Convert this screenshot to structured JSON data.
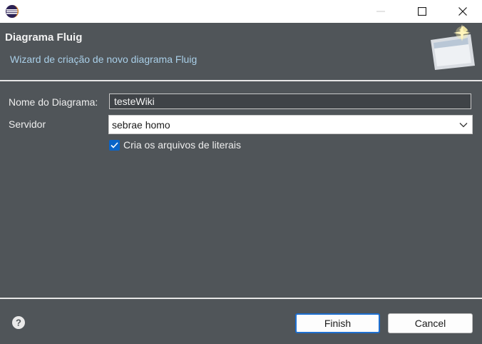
{
  "window": {
    "app_icon": "eclipse-icon",
    "controls": [
      "minimize-icon",
      "maximize-icon",
      "close-icon"
    ]
  },
  "header": {
    "title": "Diagrama Fluig",
    "description": "Wizard de criação de novo diagrama Fluig",
    "banner_icon": "new-wizard-banner-icon"
  },
  "form": {
    "name_label": "Nome do Diagrama:",
    "name_value": "testeWiki",
    "server_label": "Servidor",
    "server_value": "sebrae homo",
    "create_literals_label": "Cria os arquivos de literais",
    "create_literals_checked": true
  },
  "footer": {
    "help_icon": "help-icon",
    "finish_label": "Finish",
    "cancel_label": "Cancel"
  },
  "colors": {
    "background": "#505559",
    "description_text": "#a9cfe8",
    "checkbox_accent": "#0a64c8",
    "default_button_border": "#1d6fd0"
  }
}
